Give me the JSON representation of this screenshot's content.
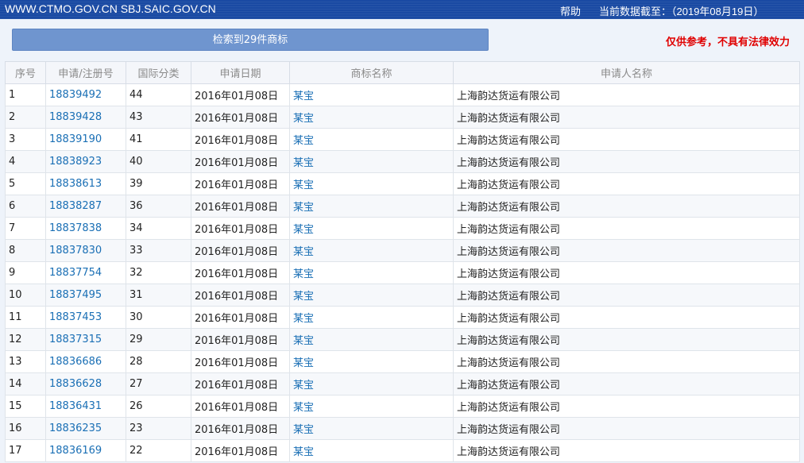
{
  "header": {
    "site": "WWW.CTMO.GOV.CN SBJ.SAIC.GOV.CN",
    "help": "帮助",
    "dateline": "当前数据截至：（2019年08月19日）"
  },
  "banner": {
    "result_count": "检索到29件商标",
    "disclaimer": "仅供参考，不具有法律效力"
  },
  "table": {
    "columns": [
      "序号",
      "申请/注册号",
      "国际分类",
      "申请日期",
      "商标名称",
      "申请人名称"
    ],
    "rows": [
      {
        "no": "1",
        "reg": "18839492",
        "cls": "44",
        "date": "2016年01月08日",
        "mark": "某宝",
        "applicant": "上海韵达货运有限公司"
      },
      {
        "no": "2",
        "reg": "18839428",
        "cls": "43",
        "date": "2016年01月08日",
        "mark": "某宝",
        "applicant": "上海韵达货运有限公司"
      },
      {
        "no": "3",
        "reg": "18839190",
        "cls": "41",
        "date": "2016年01月08日",
        "mark": "某宝",
        "applicant": "上海韵达货运有限公司"
      },
      {
        "no": "4",
        "reg": "18838923",
        "cls": "40",
        "date": "2016年01月08日",
        "mark": "某宝",
        "applicant": "上海韵达货运有限公司"
      },
      {
        "no": "5",
        "reg": "18838613",
        "cls": "39",
        "date": "2016年01月08日",
        "mark": "某宝",
        "applicant": "上海韵达货运有限公司"
      },
      {
        "no": "6",
        "reg": "18838287",
        "cls": "36",
        "date": "2016年01月08日",
        "mark": "某宝",
        "applicant": "上海韵达货运有限公司"
      },
      {
        "no": "7",
        "reg": "18837838",
        "cls": "34",
        "date": "2016年01月08日",
        "mark": "某宝",
        "applicant": "上海韵达货运有限公司"
      },
      {
        "no": "8",
        "reg": "18837830",
        "cls": "33",
        "date": "2016年01月08日",
        "mark": "某宝",
        "applicant": "上海韵达货运有限公司"
      },
      {
        "no": "9",
        "reg": "18837754",
        "cls": "32",
        "date": "2016年01月08日",
        "mark": "某宝",
        "applicant": "上海韵达货运有限公司"
      },
      {
        "no": "10",
        "reg": "18837495",
        "cls": "31",
        "date": "2016年01月08日",
        "mark": "某宝",
        "applicant": "上海韵达货运有限公司"
      },
      {
        "no": "11",
        "reg": "18837453",
        "cls": "30",
        "date": "2016年01月08日",
        "mark": "某宝",
        "applicant": "上海韵达货运有限公司"
      },
      {
        "no": "12",
        "reg": "18837315",
        "cls": "29",
        "date": "2016年01月08日",
        "mark": "某宝",
        "applicant": "上海韵达货运有限公司"
      },
      {
        "no": "13",
        "reg": "18836686",
        "cls": "28",
        "date": "2016年01月08日",
        "mark": "某宝",
        "applicant": "上海韵达货运有限公司"
      },
      {
        "no": "14",
        "reg": "18836628",
        "cls": "27",
        "date": "2016年01月08日",
        "mark": "某宝",
        "applicant": "上海韵达货运有限公司"
      },
      {
        "no": "15",
        "reg": "18836431",
        "cls": "26",
        "date": "2016年01月08日",
        "mark": "某宝",
        "applicant": "上海韵达货运有限公司"
      },
      {
        "no": "16",
        "reg": "18836235",
        "cls": "23",
        "date": "2016年01月08日",
        "mark": "某宝",
        "applicant": "上海韵达货运有限公司"
      },
      {
        "no": "17",
        "reg": "18836169",
        "cls": "22",
        "date": "2016年01月08日",
        "mark": "某宝",
        "applicant": "上海韵达货运有限公司"
      }
    ]
  },
  "colors": {
    "header_bg": "#1a4aa3",
    "banner_bg": "#6f95cf",
    "link": "#1a6fb5",
    "disclaimer": "#e00000"
  }
}
